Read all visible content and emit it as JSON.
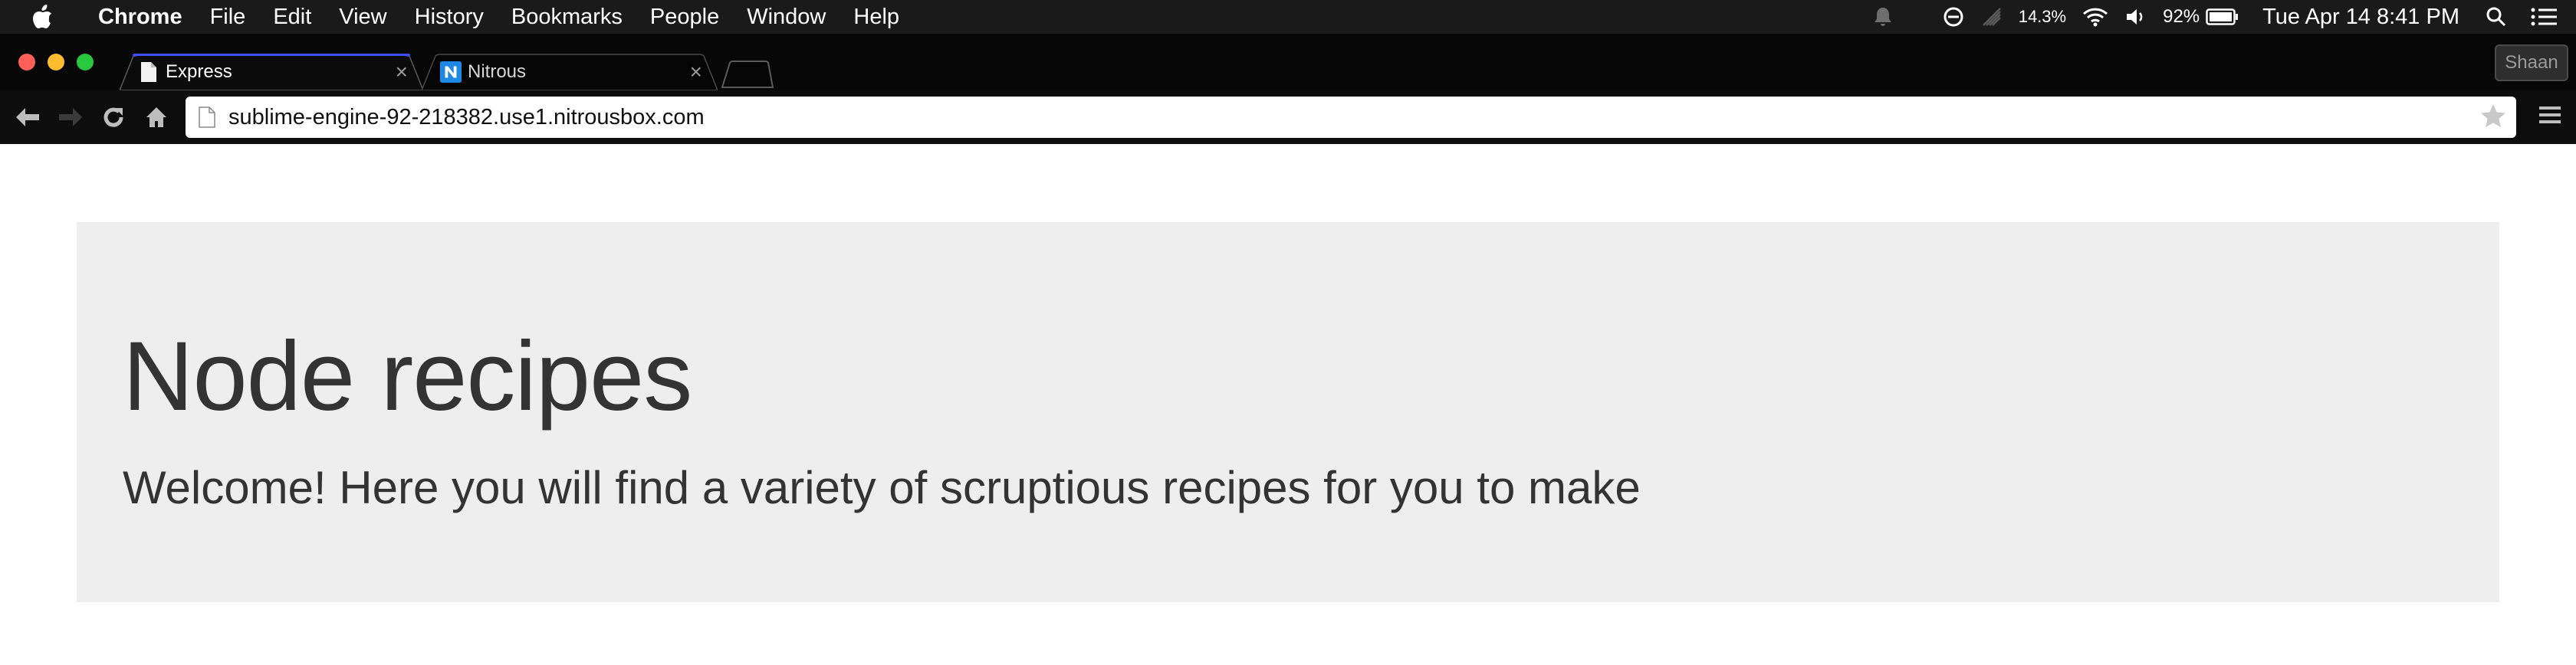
{
  "menubar": {
    "app_name": "Chrome",
    "items": [
      "File",
      "Edit",
      "View",
      "History",
      "Bookmarks",
      "People",
      "Window",
      "Help"
    ],
    "cpu_percent": "14.3%",
    "battery_percent": "92%",
    "datetime": "Tue Apr 14  8:41 PM"
  },
  "tabs": [
    {
      "title": "Express",
      "active": true,
      "favicon": "page-icon"
    },
    {
      "title": "Nitrous",
      "active": false,
      "favicon": "nitrous-logo-icon"
    }
  ],
  "profile": {
    "name": "Shaan"
  },
  "toolbar": {
    "url": "sublime-engine-92-218382.use1.nitrousbox.com"
  },
  "page": {
    "heading": "Node recipes",
    "lead": "Welcome! Here you will find a variety of scruptious recipes for you to make"
  },
  "colors": {
    "menubar_bg": "#1a1a1a",
    "tabstrip_bg": "#070707",
    "active_tab_accent": "#3f4cff",
    "jumbotron_bg": "#eeeeee",
    "text": "#333333"
  }
}
